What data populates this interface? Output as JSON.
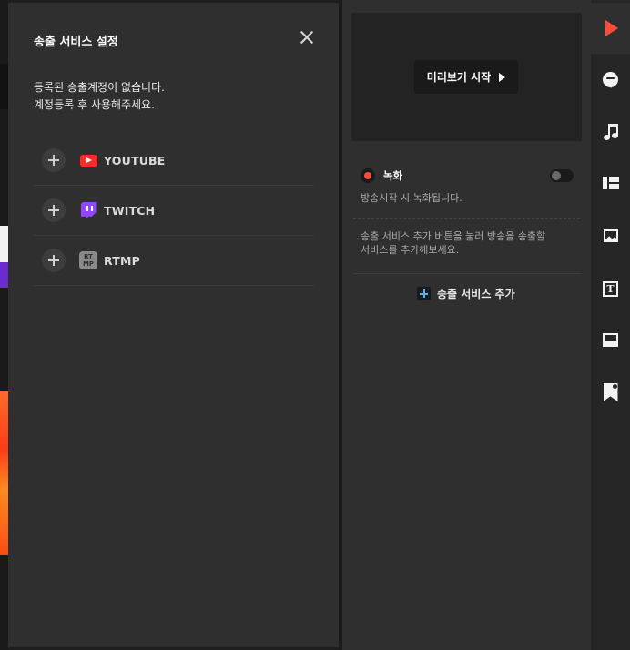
{
  "panel": {
    "title": "송출 서비스 설정",
    "notice_line1": "등록된 송출계정이 없습니다.",
    "notice_line2": "계정등록 후 사용해주세요.",
    "services": [
      {
        "label": "YOUTUBE",
        "icon": "youtube-icon"
      },
      {
        "label": "TWITCH",
        "icon": "twitch-icon"
      },
      {
        "label": "RTMP",
        "icon": "rtmp-icon",
        "icon_text_top": "RT",
        "icon_text_bottom": "MP"
      }
    ]
  },
  "preview": {
    "button_label": "미리보기 시작"
  },
  "recording": {
    "label": "녹화",
    "description": "방송시작 시 녹화됩니다.",
    "enabled": false
  },
  "service_help": {
    "line1": "송출 서비스 추가 버튼을 눌러 방송을 송출할",
    "line2": "서비스를 추가해보세요."
  },
  "add_service": {
    "label": "송출 서비스 추가"
  },
  "sidebar": {
    "items": [
      {
        "icon": "play-icon",
        "active": true
      },
      {
        "icon": "chat-icon"
      },
      {
        "icon": "music-icon"
      },
      {
        "icon": "layout-icon"
      },
      {
        "icon": "image-icon"
      },
      {
        "icon": "text-icon",
        "glyph": "T"
      },
      {
        "icon": "caption-bar-icon"
      },
      {
        "icon": "bookmark-icon"
      }
    ]
  },
  "colors": {
    "accent_play": "#ff4b3a",
    "youtube": "#ff2a2a",
    "twitch": "#9146ff",
    "add_plus": "#5ab0ff",
    "record_dot": "#ff4a3a"
  }
}
